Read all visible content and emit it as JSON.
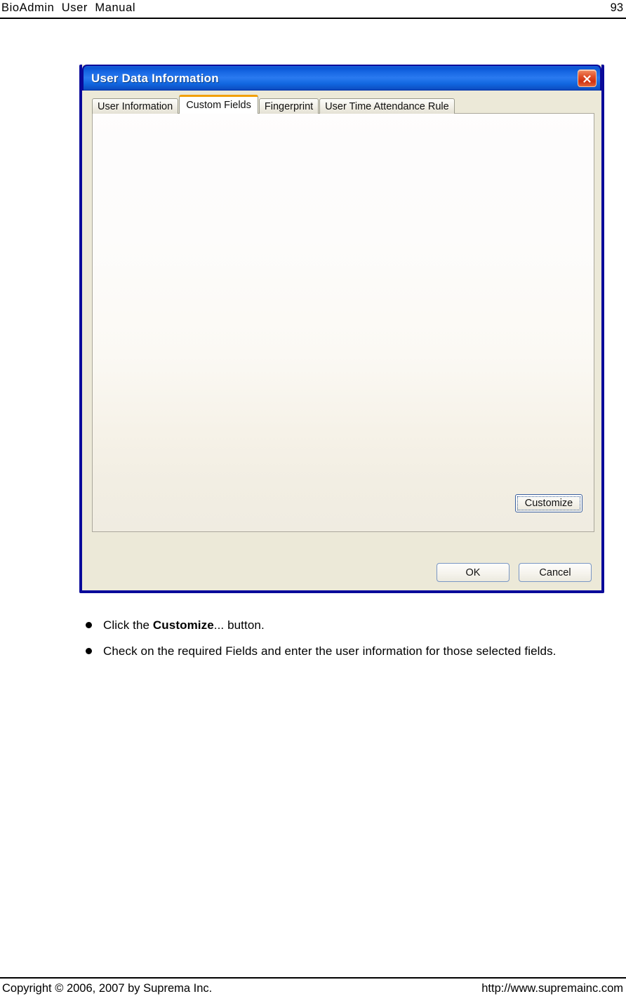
{
  "page": {
    "header_title": "BioAdmin  User  Manual",
    "page_number": "93",
    "footer_copyright": "Copyright © 2006, 2007 by Suprema Inc.",
    "footer_url": "http://www.supremainc.com"
  },
  "dialog": {
    "title": "User Data Information",
    "close_icon": "close-x-icon",
    "tabs": [
      {
        "label": "User Information",
        "active": false
      },
      {
        "label": "Custom Fields",
        "active": true
      },
      {
        "label": "Fingerprint",
        "active": false
      },
      {
        "label": "User Time Attendance Rule",
        "active": false
      }
    ],
    "customize_label": "Customize",
    "ok_label": "OK",
    "cancel_label": "Cancel",
    "colors": {
      "titlebar_blue": "#1565e2",
      "frame_blue": "#0a0a9a",
      "active_tab_accent": "#f2a007",
      "close_red": "#cf3211",
      "panel_beige": "#ece9d8"
    }
  },
  "instructions": {
    "bullet1_prefix": "Click the ",
    "bullet1_bold": "Customize",
    "bullet1_suffix": "... button.",
    "bullet2": "Check on the required Fields and enter the user information for those selected fields."
  }
}
